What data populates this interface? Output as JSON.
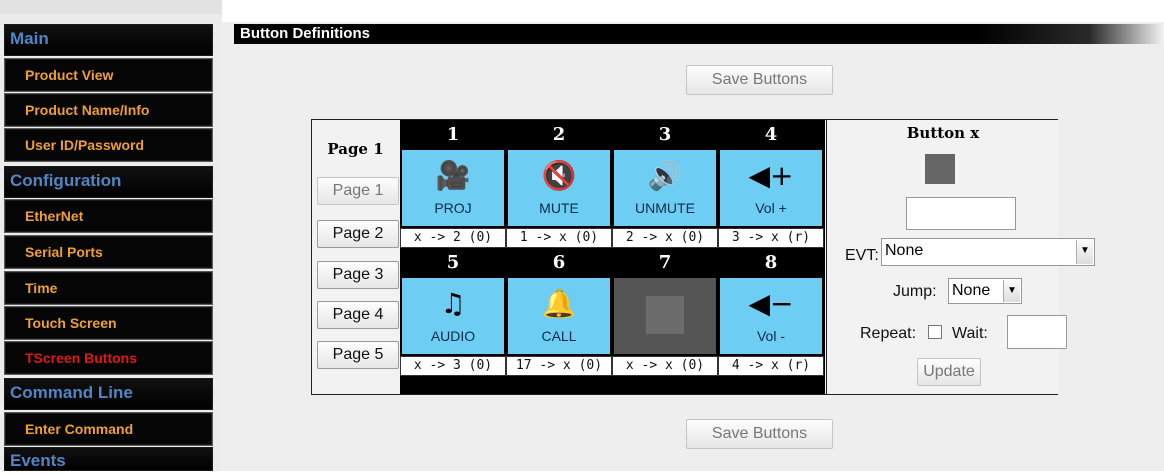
{
  "sidebar": {
    "items": [
      {
        "type": "section",
        "label": "Main"
      },
      {
        "type": "item",
        "label": "Product View"
      },
      {
        "type": "item",
        "label": "Product Name/Info"
      },
      {
        "type": "item",
        "label": "User ID/Password"
      },
      {
        "type": "section",
        "label": "Configuration"
      },
      {
        "type": "item",
        "label": "EtherNet"
      },
      {
        "type": "item",
        "label": "Serial Ports"
      },
      {
        "type": "item",
        "label": "Time"
      },
      {
        "type": "item",
        "label": "Touch Screen"
      },
      {
        "type": "item",
        "label": "TScreen Buttons",
        "active": true
      },
      {
        "type": "section",
        "label": "Command Line"
      },
      {
        "type": "item",
        "label": "Enter Command"
      },
      {
        "type": "section",
        "label": "Events"
      }
    ],
    "colors": {
      "section": "#4f86c6",
      "item": "#f0a030",
      "active": "#e01818"
    }
  },
  "main": {
    "title": "Button Definitions",
    "save_label": "Save Buttons",
    "page_label": "Page 1",
    "pages": [
      "Page 1",
      "Page 2",
      "Page 3",
      "Page 4",
      "Page 5"
    ],
    "buttons": [
      {
        "num": "1",
        "icon": "projector-icon",
        "glyph": "🎥",
        "label": "PROJ",
        "evt": "x -> 2 (0)"
      },
      {
        "num": "2",
        "icon": "mute-icon",
        "glyph": "🔇",
        "label": "MUTE",
        "evt": "1 -> x (0)"
      },
      {
        "num": "3",
        "icon": "unmute-icon",
        "glyph": "🔊",
        "label": "UNMUTE",
        "evt": "2 -> x (0)"
      },
      {
        "num": "4",
        "icon": "volume-up-icon",
        "glyph": "◀+",
        "label": "Vol +",
        "evt": "3 -> x (r)"
      },
      {
        "num": "5",
        "icon": "music-note-icon",
        "glyph": "♫",
        "label": "AUDIO",
        "evt": "x -> 3 (0)"
      },
      {
        "num": "6",
        "icon": "bell-icon",
        "glyph": "🔔",
        "label": "CALL",
        "evt": "17 -> x (0)"
      },
      {
        "num": "7",
        "icon": "",
        "glyph": "",
        "label": "",
        "evt": "x -> x (0)",
        "empty": true
      },
      {
        "num": "8",
        "icon": "volume-down-icon",
        "glyph": "◀−",
        "label": "Vol -",
        "evt": "4 -> x (r)"
      }
    ],
    "editor": {
      "title": "Button x",
      "label_value": "",
      "evt_label": "EVT:",
      "evt_value": "None",
      "jump_label": "Jump:",
      "jump_value": "None",
      "repeat_label": "Repeat:",
      "wait_label": "Wait:",
      "wait_value": "",
      "update_label": "Update"
    },
    "colors": {
      "button_bg": "#6dcdf3",
      "empty_bg": "#555555"
    }
  }
}
